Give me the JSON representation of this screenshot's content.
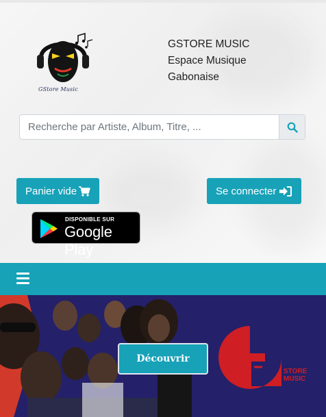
{
  "header": {
    "logo_caption": "GStore Music",
    "brand_lines": [
      "GSTORE MUSIC",
      "Espace Musique",
      "Gabonaise"
    ]
  },
  "search": {
    "placeholder": "Recherche par Artiste, Album, Titre, ...",
    "value": "",
    "icon": "search-icon"
  },
  "actions": {
    "cart_label": "Panier vide",
    "cart_icon": "cart-icon",
    "login_label": "Se connecter",
    "login_icon": "sign-in-icon"
  },
  "google_play": {
    "small_text": "DISPONIBLE SUR",
    "big_text": "Google Play"
  },
  "nav": {
    "menu_icon": "hamburger-icon"
  },
  "banner": {
    "button_label": "Découvrir",
    "logo_text_lines": [
      "STORE",
      "MUSIC"
    ]
  },
  "colors": {
    "accent": "#17a2b8",
    "banner_bg": "#24206a",
    "logo_red": "#cf1e24"
  }
}
